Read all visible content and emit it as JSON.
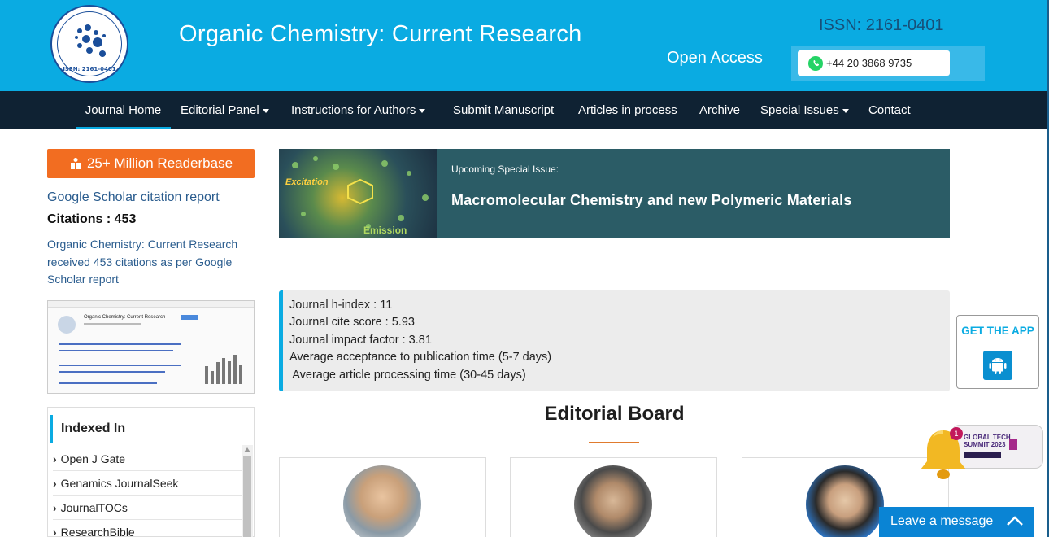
{
  "header": {
    "logo_alt_text": "Organic Chemistry: Current Research",
    "logo_issn": "ISSN: 2161-0401",
    "journal_title": "Organic Chemistry: Current Research",
    "open_access": "Open Access",
    "issn": "ISSN: 2161-0401",
    "phone": "+44 20 3868 9735",
    "brand_color": "#0aabe2"
  },
  "nav": {
    "items": [
      {
        "label": "Journal Home",
        "active": true,
        "dropdown": false
      },
      {
        "label": "Editorial Panel",
        "active": false,
        "dropdown": true
      },
      {
        "label": "Instructions for Authors",
        "active": false,
        "dropdown": true
      },
      {
        "label": "Submit Manuscript",
        "active": false,
        "dropdown": false
      },
      {
        "label": "Articles in process",
        "active": false,
        "dropdown": false
      },
      {
        "label": "Archive",
        "active": false,
        "dropdown": false
      },
      {
        "label": "Special Issues",
        "active": false,
        "dropdown": true
      },
      {
        "label": "Contact",
        "active": false,
        "dropdown": false
      }
    ]
  },
  "sidebar": {
    "readerbase_label": "25+ Million Readerbase",
    "scholar_title": "Google Scholar citation report",
    "citations_label": "Citations : 453",
    "scholar_desc": "Organic Chemistry: Current Research received 453 citations as per Google Scholar report",
    "thumb_title": "Organic Chemistry: Current Research",
    "indexed_title": "Indexed In",
    "indexed_items": [
      "Open J Gate",
      "Genamics JournalSeek",
      "JournalTOCs",
      "ResearchBible"
    ]
  },
  "banner": {
    "label": "Upcoming Special Issue:",
    "title": "Macromolecular Chemistry and new Polymeric Materials",
    "image_text_top": "Excitation",
    "image_text_bottom": "Emission"
  },
  "metrics": [
    "Journal h-index : 11",
    "Journal cite score : 5.93",
    "Journal impact factor : 3.81",
    "Average acceptance to publication time (5-7 days)",
    " Average article processing time (30-45 days)"
  ],
  "editorial": {
    "title": "Editorial Board"
  },
  "widgets": {
    "get_app": "GET THE APP",
    "notification_count": "1",
    "summit_lines": [
      "GLOBAL TECH",
      "SUMMIT 2023"
    ],
    "leave_message": "Leave a message",
    "accent": "#f26d21"
  }
}
